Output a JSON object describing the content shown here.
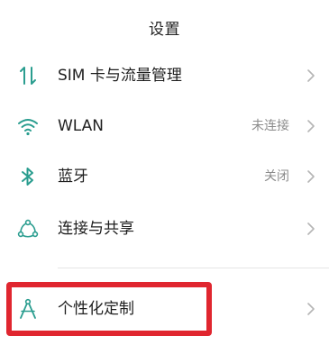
{
  "header": {
    "title": "设置"
  },
  "settings": {
    "items": [
      {
        "label": "SIM 卡与流量管理",
        "value": "",
        "icon": "sim-data-icon"
      },
      {
        "label": "WLAN",
        "value": "未连接",
        "icon": "wifi-icon"
      },
      {
        "label": "蓝牙",
        "value": "关闭",
        "icon": "bluetooth-icon"
      },
      {
        "label": "连接与共享",
        "value": "",
        "icon": "connection-share-icon"
      },
      {
        "label": "个性化定制",
        "value": "",
        "icon": "personalization-icon"
      }
    ]
  },
  "colors": {
    "accent": "#2a9d8f",
    "highlight": "#e0262f",
    "value_text": "#8c8c8c",
    "chevron": "#b5b5b5"
  }
}
